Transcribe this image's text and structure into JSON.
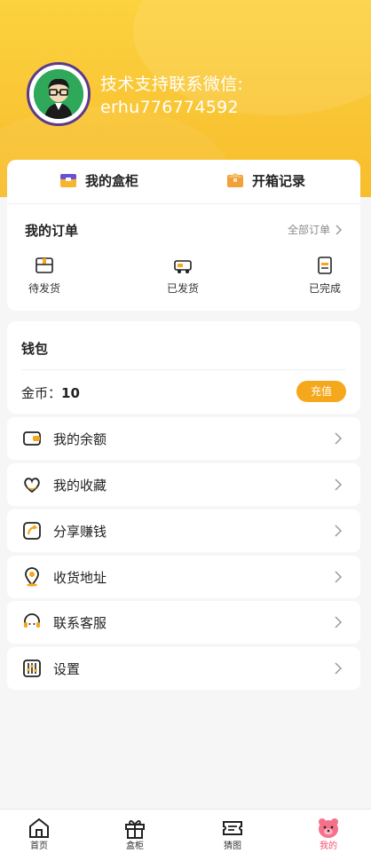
{
  "profile": {
    "support_text_line1": "技术支持联系微信:",
    "support_text_line2": "erhu776774592"
  },
  "quick_links": [
    {
      "label": "我的盒柜",
      "icon": "cabinet-box-icon"
    },
    {
      "label": "开箱记录",
      "icon": "open-box-record-icon"
    }
  ],
  "orders": {
    "title": "我的订单",
    "all_label": "全部订单",
    "items": [
      {
        "label": "待发货",
        "icon": "package-pending-icon"
      },
      {
        "label": "已发货",
        "icon": "truck-shipped-icon"
      },
      {
        "label": "已完成",
        "icon": "document-done-icon"
      }
    ]
  },
  "wallet": {
    "title": "钱包",
    "coin_label": "金币：",
    "coin_value": "10",
    "recharge_label": "充值"
  },
  "menu": [
    {
      "label": "我的余额",
      "icon": "wallet-icon"
    },
    {
      "label": "我的收藏",
      "icon": "heart-icon"
    },
    {
      "label": "分享赚钱",
      "icon": "share-icon"
    },
    {
      "label": "收货地址",
      "icon": "location-pin-icon"
    },
    {
      "label": "联系客服",
      "icon": "headset-icon"
    },
    {
      "label": "设置",
      "icon": "settings-sliders-icon"
    }
  ],
  "tabbar": [
    {
      "label": "首页",
      "icon": "home-icon",
      "active": false
    },
    {
      "label": "盒柜",
      "icon": "gift-icon",
      "active": false
    },
    {
      "label": "猜图",
      "icon": "ticket-icon",
      "active": false
    },
    {
      "label": "我的",
      "icon": "bear-face-icon",
      "active": true
    }
  ],
  "colors": {
    "header_yellow": "#fcd23e",
    "accent_orange": "#f5a81c",
    "tab_active_pink": "#f5516e"
  }
}
